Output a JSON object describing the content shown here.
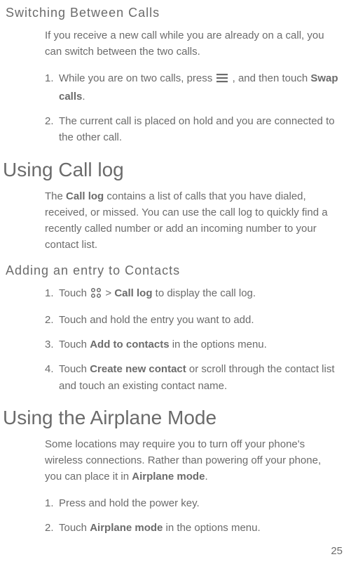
{
  "section1": {
    "heading": "Switching Between Calls",
    "para": "If you receive a new call while you are already on a call, you can switch between the two calls.",
    "step1": {
      "num": "1.",
      "pre": "While you are on two calls, press ",
      "post": ", and then touch ",
      "bold": "Swap calls",
      "tail": "."
    },
    "step2": {
      "num": "2.",
      "text": "The current call is placed on hold and you are connected to the other call."
    }
  },
  "section2": {
    "heading": "Using Call log",
    "para_pre": "The ",
    "para_bold": "Call log",
    "para_post": " contains a list of calls that you have dialed, received, or missed. You can use the call log to quickly find a recently called number or add an incoming number to your contact list."
  },
  "section3": {
    "heading": "Adding an entry to Contacts",
    "step1": {
      "num": "1.",
      "pre": "Touch ",
      "mid": " > ",
      "bold": "Call log",
      "post": " to display the call log."
    },
    "step2": {
      "num": "2.",
      "text": "Touch and hold the entry you want to add."
    },
    "step3": {
      "num": "3.",
      "pre": "Touch ",
      "bold": "Add to contacts",
      "post": " in the options menu."
    },
    "step4": {
      "num": "4.",
      "pre": "Touch ",
      "bold": "Create new contact",
      "post": " or scroll through the contact list and touch an existing contact name."
    }
  },
  "section4": {
    "heading": "Using the Airplane Mode",
    "para_pre": "Some locations may require you to turn off your phone's wireless connections. Rather than powering off your phone, you can place it in ",
    "para_bold": "Airplane mode",
    "para_post": ".",
    "step1": {
      "num": "1.",
      "text": "Press and hold the power key."
    },
    "step2": {
      "num": "2.",
      "pre": "Touch ",
      "bold": "Airplane mode",
      "post": " in the options menu."
    }
  },
  "page_number": "25"
}
